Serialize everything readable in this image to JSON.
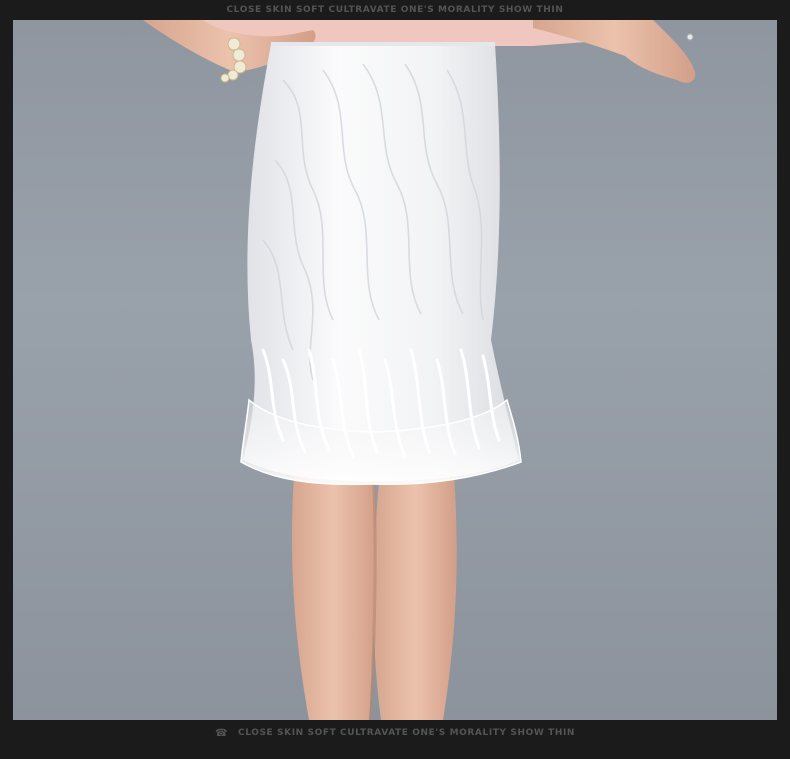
{
  "header": {
    "tagline": "CLOSE SKIN SOFT CULTRAVATE ONE'S MORALITY SHOW THIN"
  },
  "footer": {
    "icon": "phone-icon",
    "tagline": "CLOSE SKIN SOFT CULTRAVATE ONE'S MORALITY SHOW THIN"
  },
  "photo": {
    "subject": "",
    "colors": {
      "background": "#939aa3",
      "skirt": "#f4f4f6",
      "skin": "#e3b8a3",
      "top": "#f0c7be",
      "frame": "#1b1b1b"
    }
  }
}
